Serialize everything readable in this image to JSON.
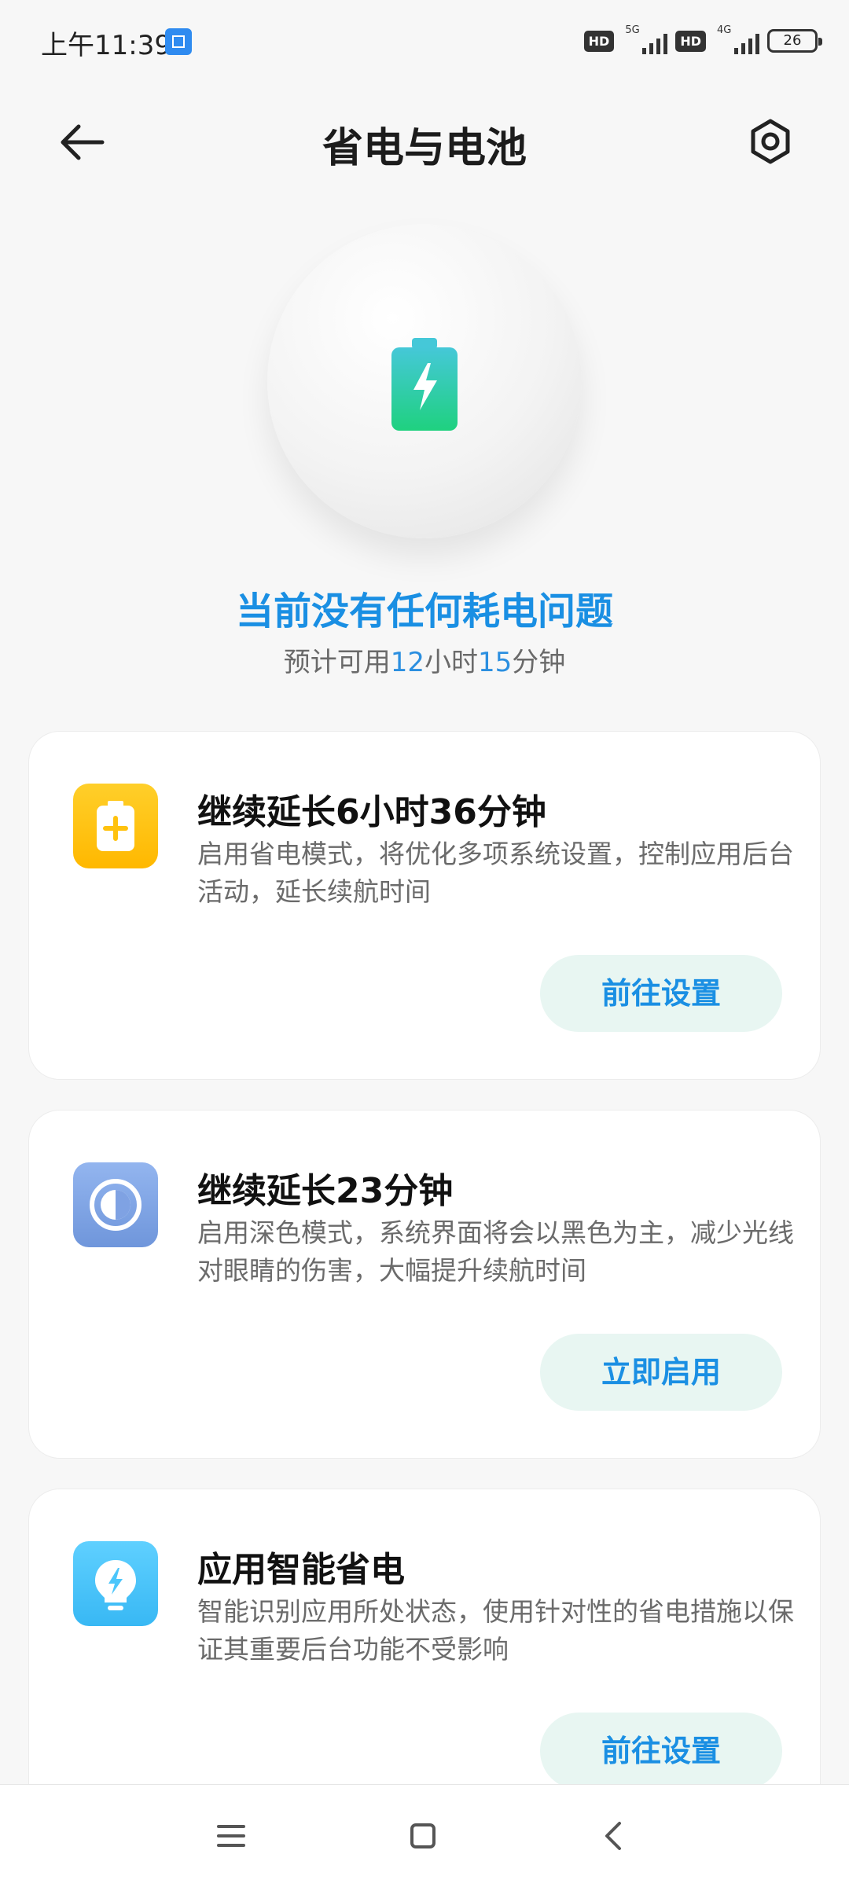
{
  "status_bar": {
    "time": "上午11:39",
    "hd_label": "HD",
    "sim1_label": "5G",
    "sim2_label": "4G",
    "battery_level": "26"
  },
  "header": {
    "title": "省电与电池"
  },
  "hero": {
    "status_text": "当前没有任何耗电问题",
    "estimate_prefix": "预计可用",
    "estimate_hours": "12",
    "estimate_hours_unit": "小时",
    "estimate_minutes": "15",
    "estimate_minutes_unit": "分钟"
  },
  "cards": [
    {
      "title": "继续延长6小时36分钟",
      "desc": "启用省电模式，将优化多项系统设置，控制应用后台活动，延长续航时间",
      "button": "前往设置",
      "icon": "battery-plus-icon",
      "icon_color": "#FFC20E"
    },
    {
      "title": "继续延长23分钟",
      "desc": "启用深色模式，系统界面将会以黑色为主，减少光线对眼睛的伤害，大幅提升续航时间",
      "button": "立即启用",
      "icon": "dark-mode-icon",
      "icon_color": "#7FA2E3"
    },
    {
      "title": "应用智能省电",
      "desc": "智能识别应用所处状态，使用针对性的省电措施以保证其重要后台功能不受影响",
      "button": "前往设置",
      "icon": "bulb-bolt-icon",
      "icon_color": "#4CC6FB"
    }
  ],
  "colors": {
    "accent_blue": "#1A8FE3",
    "button_bg": "#E8F6F2",
    "battery_green": "#1FD17F"
  }
}
